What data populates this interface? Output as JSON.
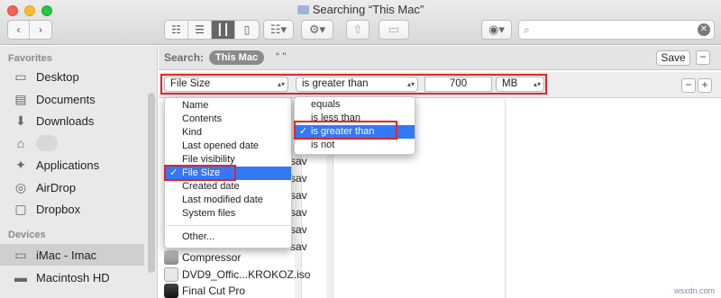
{
  "window": {
    "title": "Searching “This Mac”"
  },
  "toolbar": {
    "back_icon": "chevron-left-icon",
    "forward_icon": "chevron-right-icon",
    "views": [
      "icon-view",
      "list-view",
      "column-view",
      "cover-flow-view"
    ],
    "active_view": "column-view",
    "search": {
      "value": "",
      "placeholder": ""
    }
  },
  "sidebar": {
    "favorites_heading": "Favorites",
    "favorites": [
      {
        "label": "Desktop",
        "icon": "desktop-icon"
      },
      {
        "label": "Documents",
        "icon": "documents-icon"
      },
      {
        "label": "Downloads",
        "icon": "downloads-icon"
      },
      {
        "label": "",
        "icon": "home-icon"
      },
      {
        "label": "Applications",
        "icon": "applications-icon"
      },
      {
        "label": "AirDrop",
        "icon": "airdrop-icon"
      },
      {
        "label": "Dropbox",
        "icon": "folder-icon"
      }
    ],
    "devices_heading": "Devices",
    "devices": [
      {
        "label": "iMac - Imac",
        "icon": "imac-icon",
        "selected": true
      },
      {
        "label": "Macintosh HD",
        "icon": "disk-icon"
      }
    ]
  },
  "search_bar": {
    "label": "Search:",
    "scope_selected": "This Mac",
    "scope_other": "“   ”",
    "save_label": "Save",
    "minus_label": "−"
  },
  "criteria": {
    "attribute": "File Size",
    "operator": "is greater than",
    "value": "700",
    "unit": "MB",
    "remove_label": "−",
    "add_label": "+"
  },
  "attribute_menu": {
    "items": [
      "Name",
      "Contents",
      "Kind",
      "Last opened date",
      "File visibility",
      "File Size",
      "Created date",
      "Last modified date",
      "System files"
    ],
    "selected": "File Size",
    "other": "Other..."
  },
  "operator_menu": {
    "items": [
      "equals",
      "is less than",
      "is greater than",
      "is not"
    ],
    "selected": "is greater than"
  },
  "results": {
    "files": [
      {
        "name": "Compressor",
        "icon": "compressor-icon"
      },
      {
        "name": "DVD9_Offic...KROKOZ.iso",
        "icon": "disk-image-icon"
      },
      {
        "name": "Final Cut Pro",
        "icon": "final-cut-icon"
      }
    ],
    "peek_suffix": "sav"
  },
  "check_mark": "✓",
  "watermark": "wsxdn.com"
}
